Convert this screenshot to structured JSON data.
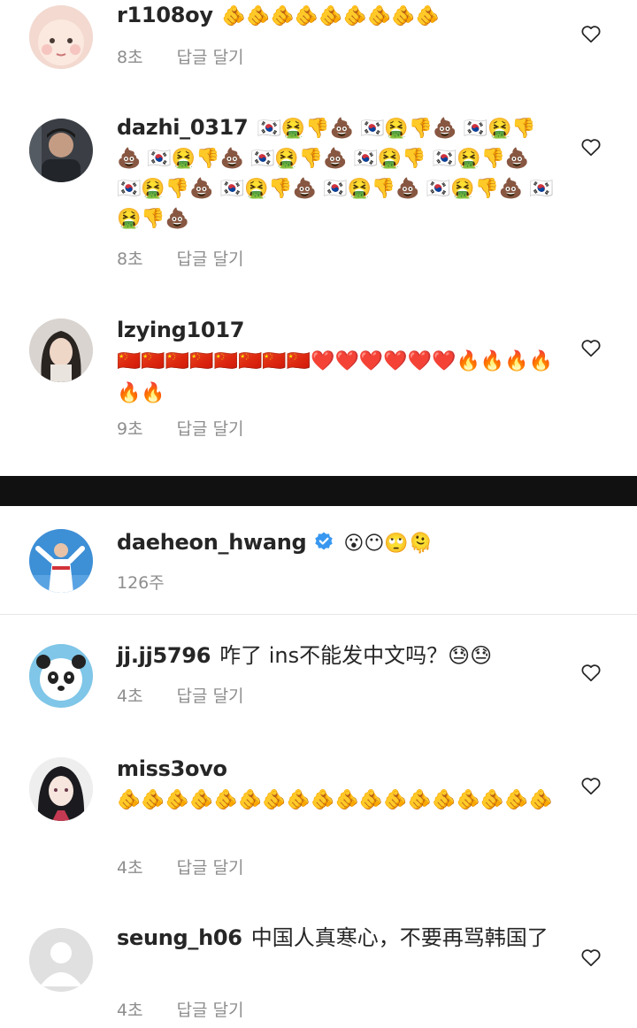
{
  "comments_top": [
    {
      "username": "r1108oy",
      "body": "🫵🫵🫵🫵🫵🫵🫵🫵🫵",
      "time": "8초",
      "reply_label": "답글 달기"
    },
    {
      "username": "dazhi_0317",
      "body": "🇰🇷🤮👎💩 🇰🇷🤮👎💩 🇰🇷🤮👎💩 🇰🇷🤮👎💩 🇰🇷🤮👎💩 🇰🇷🤮👎 🇰🇷🤮👎💩 🇰🇷🤮👎💩 🇰🇷🤮👎💩 🇰🇷🤮👎💩 🇰🇷🤮👎💩 🇰🇷🤮👎💩",
      "time": "8초",
      "reply_label": "답글 달기"
    },
    {
      "username": "lzying1017",
      "body": "🇨🇳🇨🇳🇨🇳🇨🇳🇨🇳🇨🇳🇨🇳🇨🇳❤️❤️❤️❤️❤️❤️🔥🔥🔥🔥🔥🔥",
      "time": "9초",
      "reply_label": "답글 달기"
    }
  ],
  "post": {
    "username": "daeheon_hwang",
    "body": "😮😶🙄🫠",
    "time": "126주"
  },
  "comments_bottom": [
    {
      "username": "jj.jj5796",
      "body": "咋了 ins不能发中文吗？😓😓",
      "time": "4초",
      "reply_label": "답글 달기"
    },
    {
      "username": "miss3ovo",
      "body": "🫵🫵🫵🫵🫵🫵🫵🫵🫵🫵🫵🫵🫵🫵🫵🫵🫵🫵",
      "time": "4초",
      "reply_label": "답글 달기"
    },
    {
      "username": "seung_h06",
      "body": "中国人真寒心，不要再骂韩国了",
      "time": "4초",
      "reply_label": "답글 달기"
    }
  ],
  "colors": {
    "text": "#262626",
    "meta": "#8e8e8e",
    "verified": "#3897f0",
    "divider": "#111111"
  }
}
